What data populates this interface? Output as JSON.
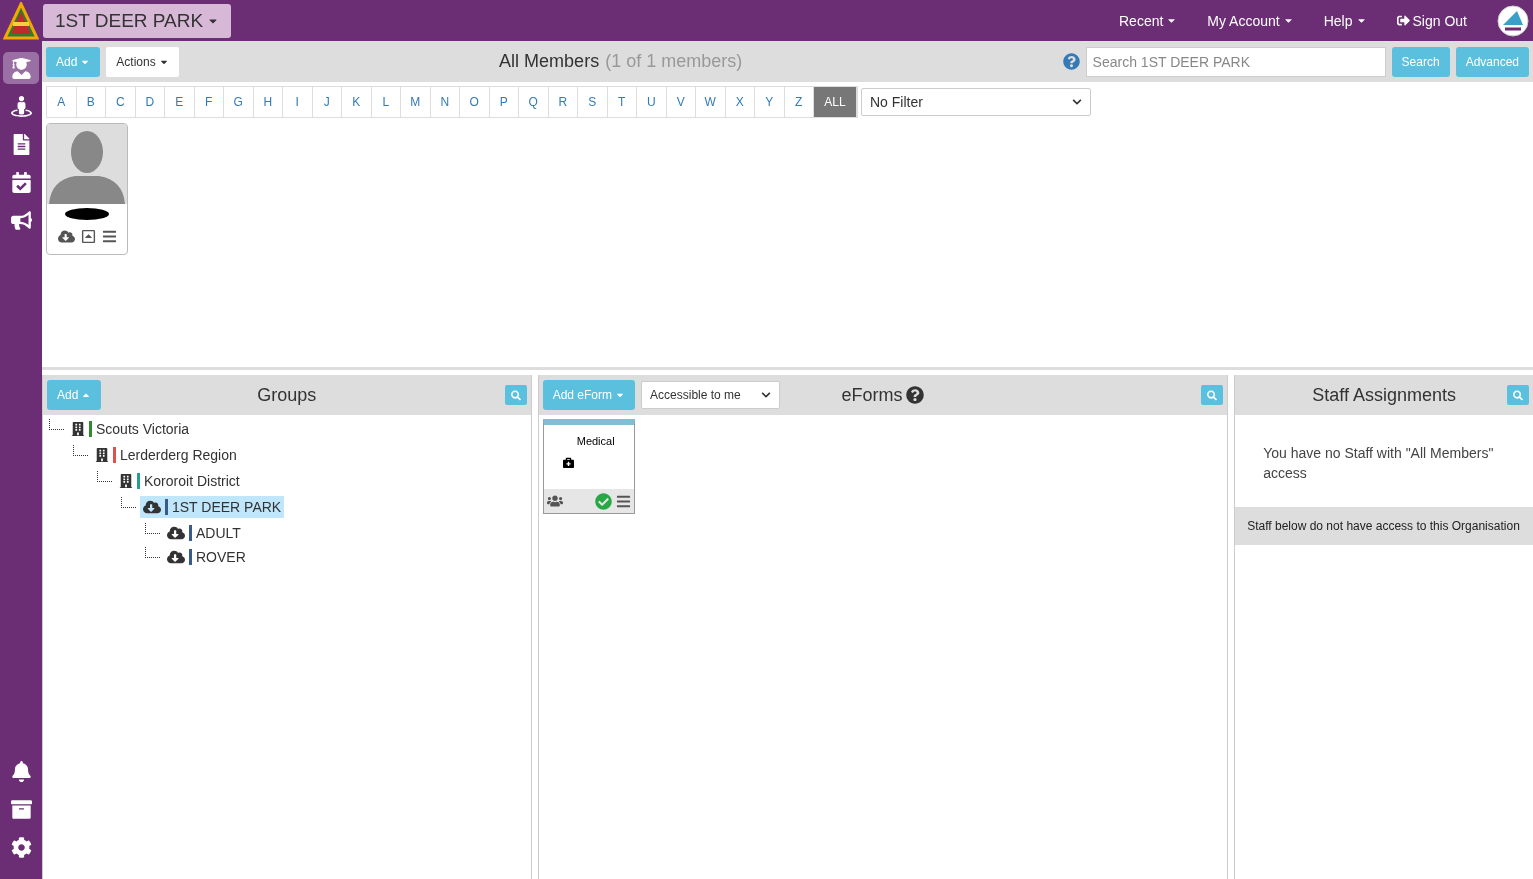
{
  "top_bar": {
    "org_button": "1ST DEER PARK",
    "menus": [
      "Recent",
      "My Account",
      "Help"
    ],
    "sign_out": "Sign Out"
  },
  "sidebar": {
    "top_items": [
      {
        "selected": true
      },
      {
        "selected": false
      },
      {
        "selected": false
      },
      {
        "selected": false
      },
      {
        "selected": false
      }
    ],
    "bottom_items": [
      {
        "selected": false
      },
      {
        "selected": false
      },
      {
        "selected": false
      }
    ]
  },
  "members": {
    "add_button": "Add",
    "actions_button": "Actions",
    "title": "All Members",
    "count": "(1 of 1 members)",
    "search": {
      "placeholder": "Search 1ST DEER PARK"
    },
    "search_button": "Search",
    "advanced_button": "Advanced",
    "letters": [
      {
        "label": "A",
        "selected": false
      },
      {
        "label": "B",
        "selected": false
      },
      {
        "label": "C",
        "selected": false
      },
      {
        "label": "D",
        "selected": false
      },
      {
        "label": "E",
        "selected": false
      },
      {
        "label": "F",
        "selected": false
      },
      {
        "label": "G",
        "selected": false
      },
      {
        "label": "H",
        "selected": false
      },
      {
        "label": "I",
        "selected": false
      },
      {
        "label": "J",
        "selected": false
      },
      {
        "label": "K",
        "selected": false
      },
      {
        "label": "L",
        "selected": false
      },
      {
        "label": "M",
        "selected": false
      },
      {
        "label": "N",
        "selected": false
      },
      {
        "label": "O",
        "selected": false
      },
      {
        "label": "P",
        "selected": false
      },
      {
        "label": "Q",
        "selected": false
      },
      {
        "label": "R",
        "selected": false
      },
      {
        "label": "S",
        "selected": false
      },
      {
        "label": "T",
        "selected": false
      },
      {
        "label": "U",
        "selected": false
      },
      {
        "label": "V",
        "selected": false
      },
      {
        "label": "W",
        "selected": false
      },
      {
        "label": "X",
        "selected": false
      },
      {
        "label": "Y",
        "selected": false
      },
      {
        "label": "Z",
        "selected": false
      },
      {
        "label": "ALL",
        "selected": true
      }
    ],
    "filter": "No Filter"
  },
  "groups": {
    "add_button": "Add",
    "title": "Groups",
    "tree": [
      {
        "label": "Scouts Victoria",
        "kind": "building",
        "color": "#2e8b2e",
        "selected": false,
        "children": [
          {
            "label": "Lerderderg Region",
            "kind": "building",
            "color": "#d9534f",
            "selected": false,
            "children": [
              {
                "label": "Kororoit District",
                "kind": "building",
                "color": "#20a090",
                "selected": false,
                "children": [
                  {
                    "label": "1ST DEER PARK",
                    "kind": "cloud",
                    "color": "#3a5a8c",
                    "selected": true,
                    "children": [
                      {
                        "label": "ADULT",
                        "kind": "cloud",
                        "color": "#3a5a8c",
                        "selected": false
                      },
                      {
                        "label": "ROVER",
                        "kind": "cloud",
                        "color": "#3a5a8c",
                        "selected": false
                      }
                    ]
                  }
                ]
              }
            ]
          }
        ]
      }
    ]
  },
  "eforms": {
    "add_button": "Add eForm",
    "filter": "Accessible to me",
    "title": "eForms",
    "cards": [
      {
        "label": "Medical"
      }
    ]
  },
  "staff": {
    "title": "Staff Assignments",
    "message": "You have no Staff with \"All Members\" access",
    "notice": "Staff below do not have access to this Organisation"
  }
}
